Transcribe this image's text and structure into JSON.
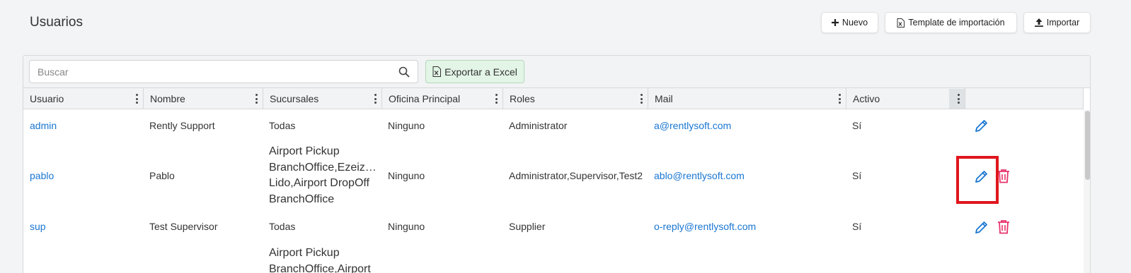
{
  "page": {
    "title": "Usuarios"
  },
  "header_buttons": {
    "nuevo": "Nuevo",
    "template": "Template de importación",
    "importar": "Importar"
  },
  "toolbar": {
    "search_placeholder": "Buscar",
    "export_label": "Exportar a Excel"
  },
  "columns": [
    "Usuario",
    "Nombre",
    "Sucursales",
    "Oficina Principal",
    "Roles",
    "Mail",
    "Activo"
  ],
  "rows": [
    {
      "usuario": "admin",
      "nombre": "Rently Support",
      "sucursales": [
        "Todas"
      ],
      "oficina": "Ninguno",
      "roles": "Administrator",
      "mail": "a@rentlysoft.com",
      "activo": "Sí"
    },
    {
      "usuario": "pablo",
      "nombre": "Pablo",
      "sucursales": [
        "Airport Pickup",
        "BranchOffice,Ezeiza,Ae…",
        "Lido,Airport DropOff",
        "BranchOffice"
      ],
      "oficina": "Ninguno",
      "roles": "Administrator,Supervisor,Test2",
      "mail": "ablo@rentlysoft.com",
      "activo": "Sí"
    },
    {
      "usuario": "sup",
      "nombre": "Test Supervisor",
      "sucursales": [
        "Todas"
      ],
      "oficina": "Ninguno",
      "roles": "Supplier",
      "mail": "o-reply@rentlysoft.com",
      "activo": "Sí"
    },
    {
      "usuario": "",
      "nombre": "",
      "sucursales": [
        "Airport Pickup",
        "BranchOffice,Airport"
      ],
      "oficina": "",
      "roles": "",
      "mail": "",
      "activo": ""
    }
  ],
  "icons": {
    "edit": "pencil-icon",
    "delete": "trash-icon",
    "search": "search-icon",
    "excel": "excel-file-icon",
    "plus": "plus-icon",
    "upload": "upload-icon"
  },
  "colors": {
    "link": "#1976d2",
    "delete": "#e8336d",
    "highlight": "#e0161d",
    "export_bg": "#e3f5e6"
  }
}
